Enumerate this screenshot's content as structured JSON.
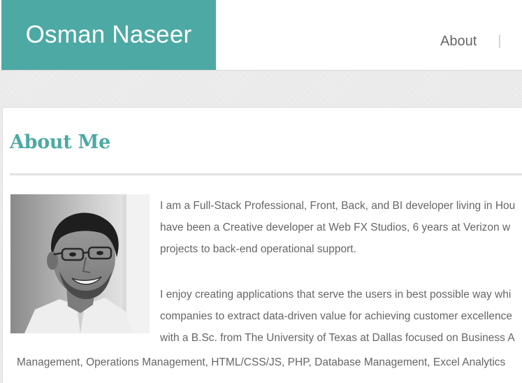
{
  "header": {
    "brand_name": "Osman Naseer",
    "nav": [
      {
        "label": "About"
      }
    ],
    "separator": "|"
  },
  "about": {
    "title": "About Me",
    "paragraph_1_lines": [
      "I am a Full-Stack Professional, Front, Back, and BI developer living in Hou",
      "have been a Creative developer at Web FX Studios, 6 years at Verizon w",
      "projects to back-end operational support."
    ],
    "paragraph_2_lines": [
      "I enjoy creating applications that serve the users in best possible way whi",
      "companies to extract data-driven value for achieving customer excellence",
      "with a B.Sc. from The University of Texas at Dallas focused on Business A"
    ],
    "paragraph_2_wrap_line": "Management, Operations Management, HTML/CSS/JS, PHP, Database Management, Excel Analytics"
  },
  "colors": {
    "accent": "#4da9a3",
    "text": "#666666"
  }
}
